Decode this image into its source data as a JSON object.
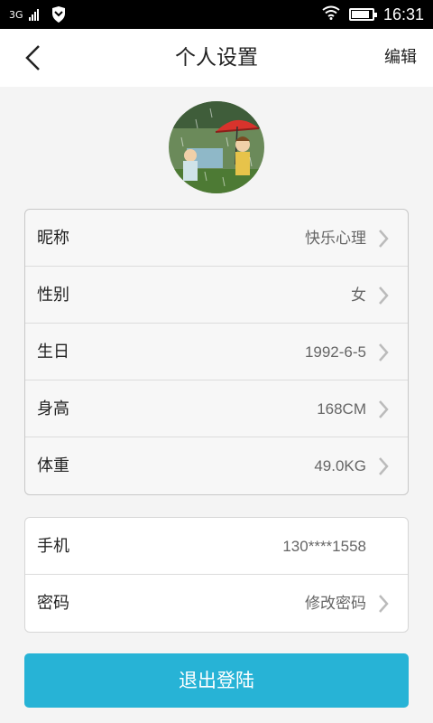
{
  "status_bar": {
    "network": "3G",
    "time": "16:31",
    "battery_level": 0.85
  },
  "nav": {
    "title": "个人设置",
    "edit_label": "编辑",
    "back_icon": "back-arrow-icon"
  },
  "profile": {
    "avatar_icon": "avatar-illustration"
  },
  "basic_info": [
    {
      "label": "昵称",
      "value": "快乐心理"
    },
    {
      "label": "性别",
      "value": "女"
    },
    {
      "label": "生日",
      "value": "1992-6-5"
    },
    {
      "label": "身高",
      "value": "168CM"
    },
    {
      "label": "体重",
      "value": "49.0KG"
    }
  ],
  "account": [
    {
      "label": "手机",
      "value": "130****1558"
    },
    {
      "label": "密码",
      "value": "修改密码"
    }
  ],
  "logout_label": "退出登陆",
  "colors": {
    "accent": "#27b3d6",
    "status_bar": "#000000",
    "background": "#f4f4f4"
  }
}
